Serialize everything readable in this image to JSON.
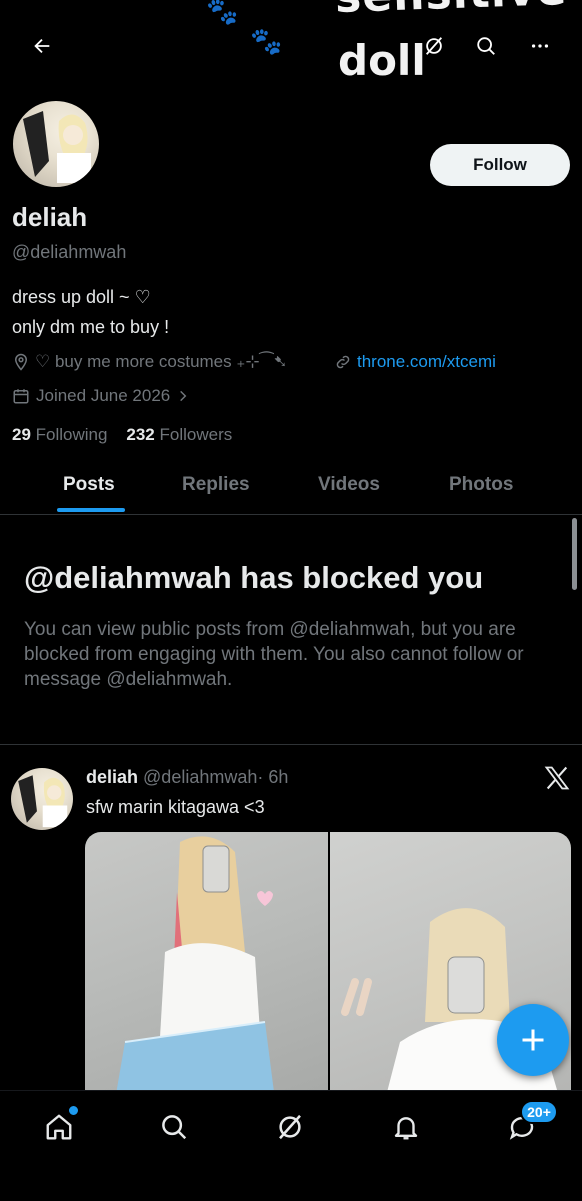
{
  "banner": {
    "line1": "sensitive",
    "line2": "doll",
    "paws": [
      "🐾",
      "🐾"
    ]
  },
  "header": {
    "back_icon": "arrow-left-icon",
    "grok_icon": "grok-icon",
    "search_icon": "search-icon",
    "more_icon": "more-icon"
  },
  "profile": {
    "follow_label": "Follow",
    "name": "deliah",
    "handle": "@deliahmwah",
    "bio_line1": "dress up doll ~ ♡",
    "bio_line2": "only dm me to buy !",
    "location": "♡ buy me more costumes ₊⊹⁀➷",
    "website": "throne.com/xtcemi",
    "joined": "Joined June 2026",
    "following_count": "29",
    "following_label": "Following",
    "followers_count": "232",
    "followers_label": "Followers"
  },
  "tabs": [
    {
      "label": "Posts"
    },
    {
      "label": "Replies"
    },
    {
      "label": "Videos"
    },
    {
      "label": "Photos"
    }
  ],
  "blocked": {
    "title": "@deliahmwah has blocked you",
    "body": "You can view public posts from @deliahmwah, but you are blocked from engaging with them. You also cannot follow or message @deliahmwah."
  },
  "post": {
    "name": "deliah",
    "handle": "@deliahmwah",
    "time": "· 6h",
    "text": "sfw marin kitagawa <3"
  },
  "nav": {
    "badge": "20+"
  },
  "colors": {
    "accent": "#1d9bf0",
    "muted": "#71767b",
    "text": "#e7e9ea",
    "bg": "#000000"
  }
}
